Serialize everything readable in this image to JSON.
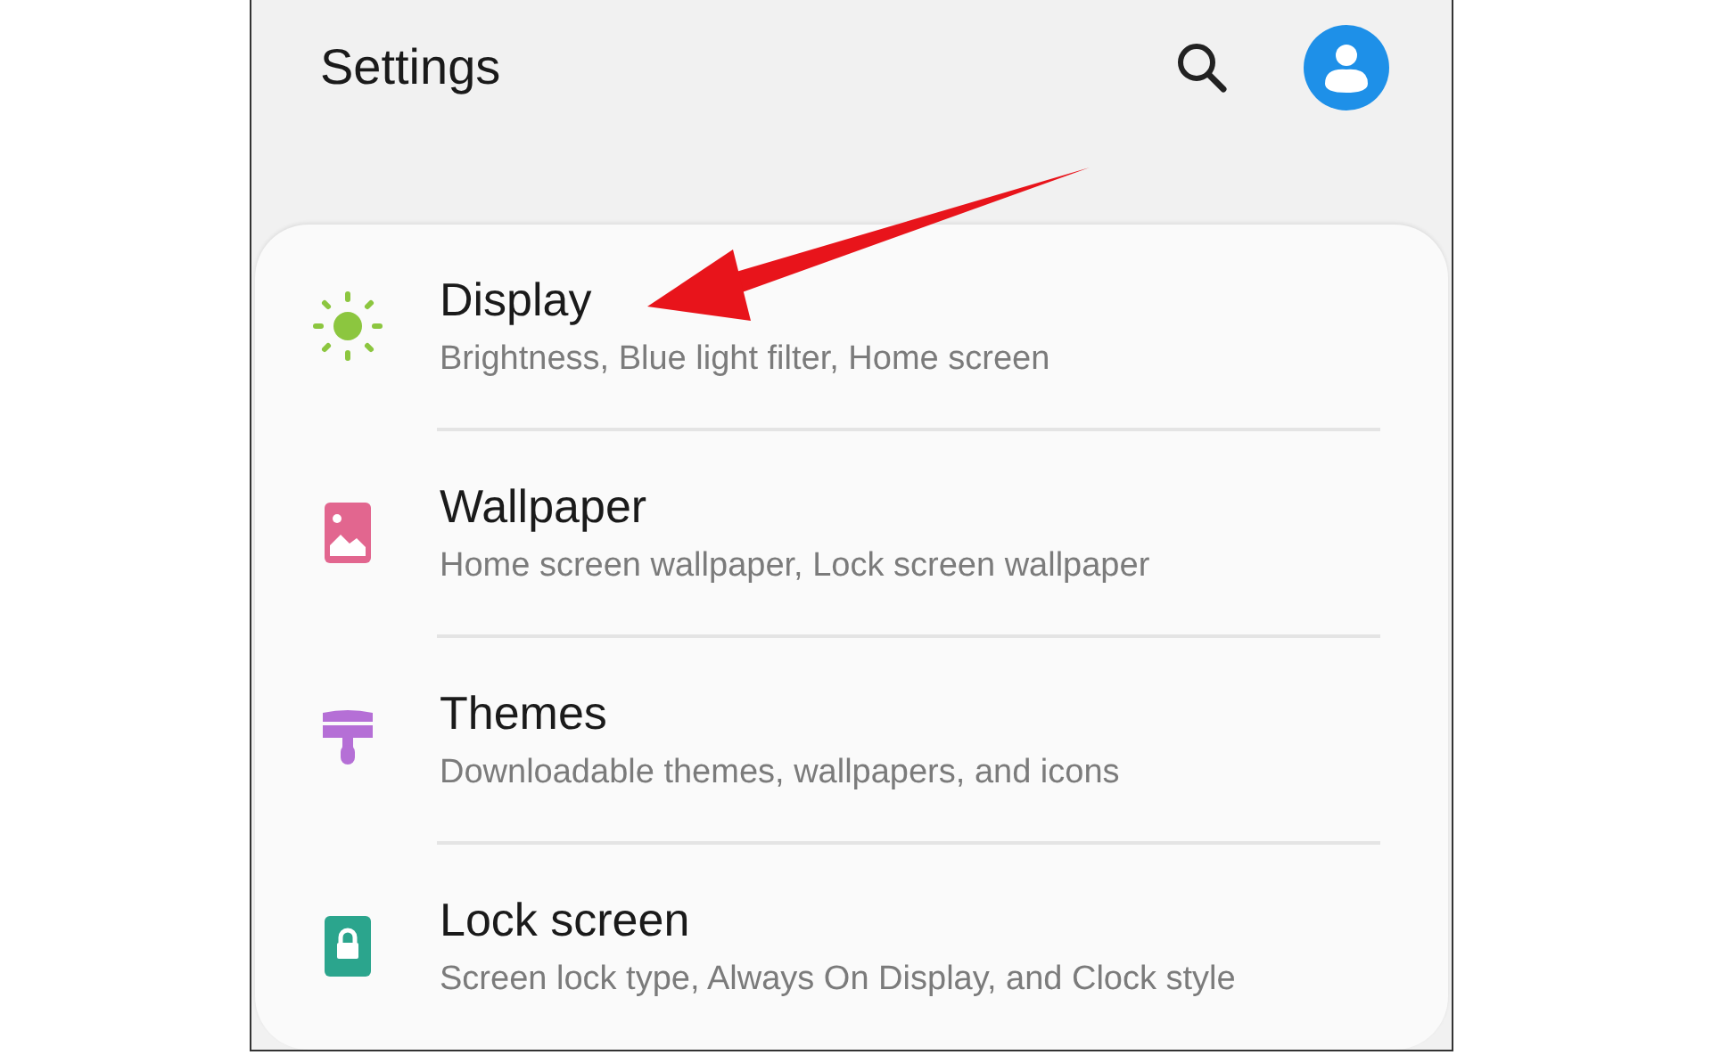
{
  "header": {
    "title": "Settings"
  },
  "items": [
    {
      "kind": "display",
      "title": "Display",
      "subtitle": "Brightness, Blue light filter, Home screen",
      "color": "#8cc63f"
    },
    {
      "kind": "wallpaper",
      "title": "Wallpaper",
      "subtitle": "Home screen wallpaper, Lock screen wallpaper",
      "color": "#e2668f"
    },
    {
      "kind": "themes",
      "title": "Themes",
      "subtitle": "Downloadable themes, wallpapers, and icons",
      "color": "#b56fd6"
    },
    {
      "kind": "lock",
      "title": "Lock screen",
      "subtitle": "Screen lock type, Always On Display, and Clock style",
      "color": "#2ba58d"
    }
  ],
  "annotation": {
    "kind": "arrow",
    "color": "#e8141b"
  }
}
